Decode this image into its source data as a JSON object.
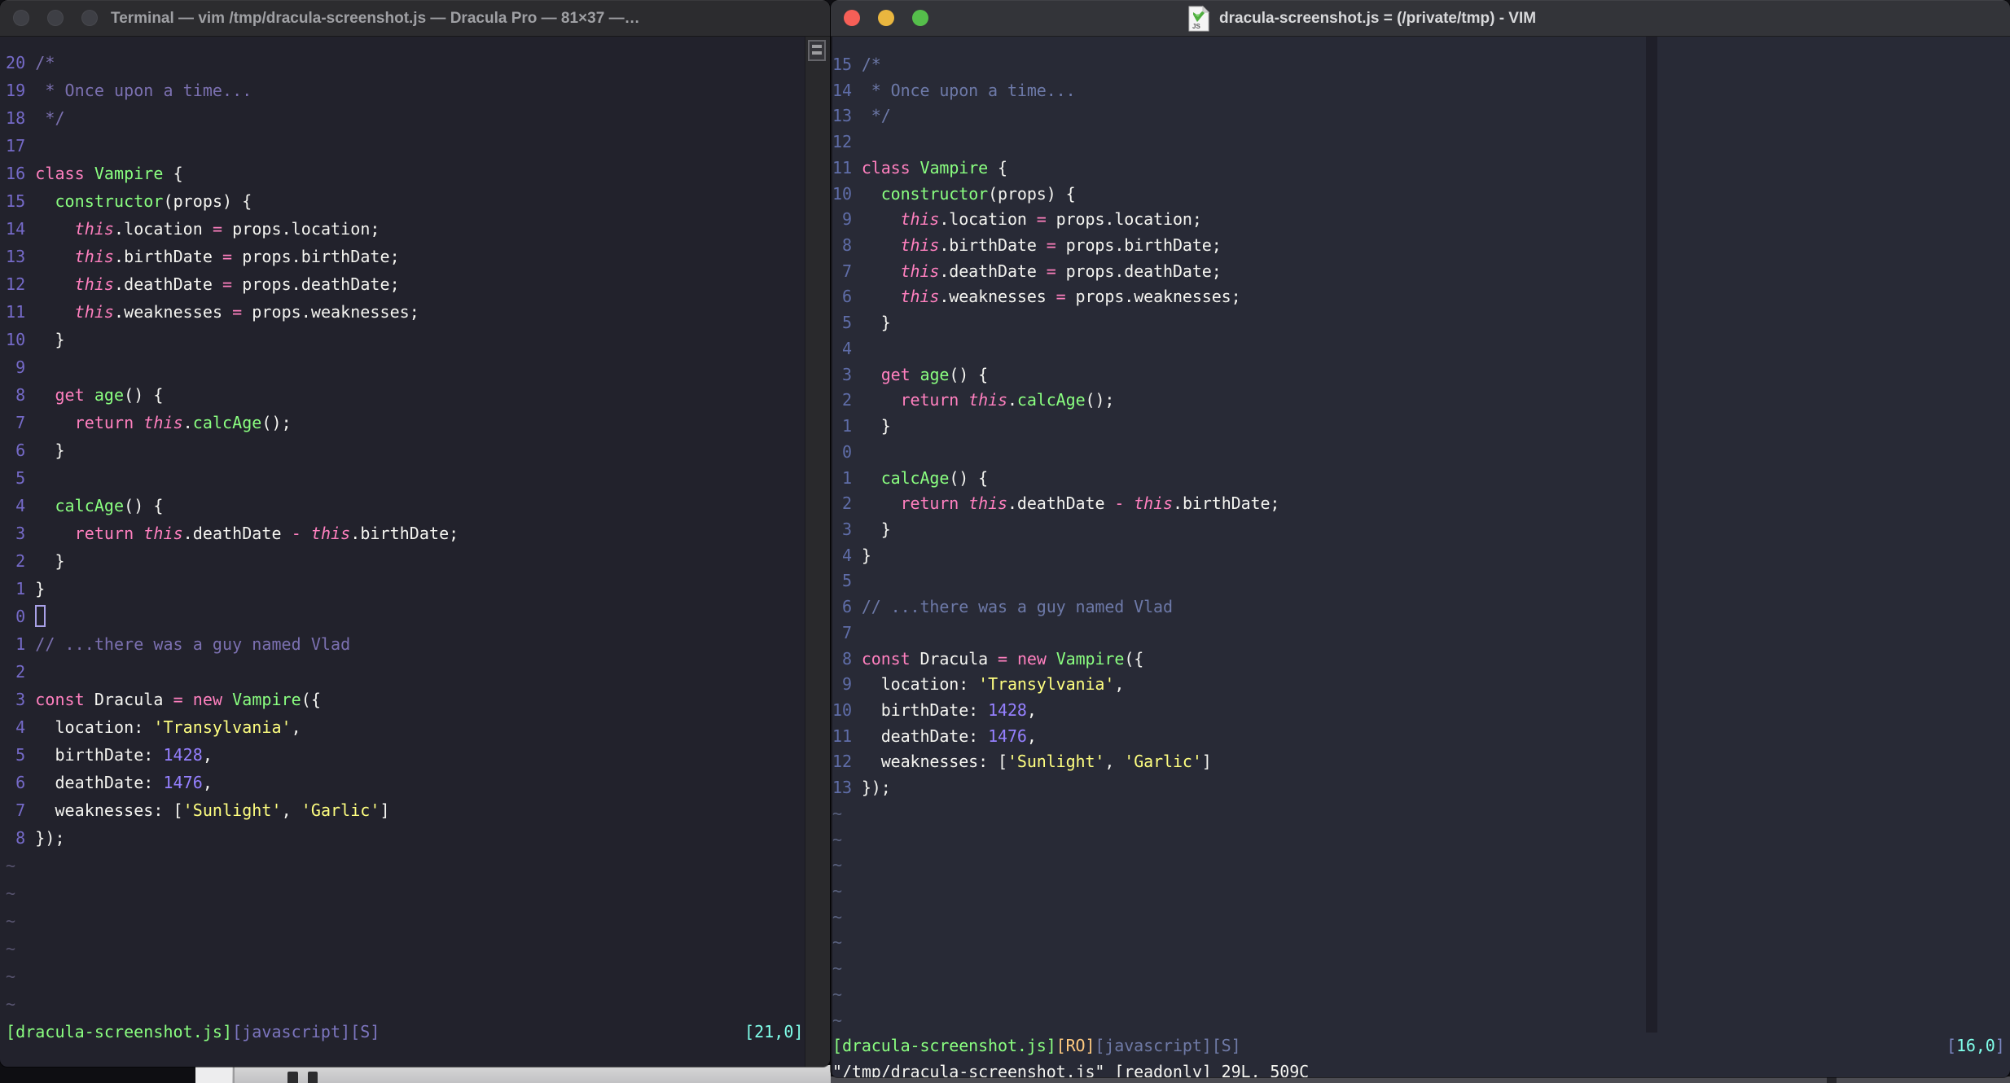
{
  "palette": {
    "shared": {
      "fg": "#F4F4F0",
      "pink": "#FF80BF",
      "green": "#8AFF80",
      "purple": "#9580FF",
      "yellow": "#FFFF80",
      "orange": "#FFCA80",
      "cyan": "#80FFEA"
    },
    "left": {
      "bg": "#22222C",
      "linenr": "#756AC8",
      "comment": "#7B70B0",
      "tilde": "#56536E",
      "slate": "#7D76C0",
      "titlebar": "#2C2C2F",
      "title_text": "#9FA0A4",
      "cursor_outline": "#A9A1E8"
    },
    "right": {
      "bg": "#282A36",
      "linenr": "#5F6DA8",
      "comment": "#6D79A8",
      "tilde": "#59617E",
      "slate": "#6F7AA6",
      "bracket": "#7B87C2",
      "titlebar": "#333439",
      "title_text": "#D8D9DB",
      "traffic_red": "#F65F57",
      "traffic_yellow": "#E9B63F",
      "traffic_green": "#55BE4B"
    }
  },
  "code_lines": [
    [
      [
        "cm",
        "/*"
      ]
    ],
    [
      [
        "cm",
        " * Once upon a time..."
      ]
    ],
    [
      [
        "cm",
        " */"
      ]
    ],
    [],
    [
      [
        "pk",
        "class"
      ],
      [
        "fg",
        " "
      ],
      [
        "gr",
        "Vampire"
      ],
      [
        "fg",
        " {"
      ]
    ],
    [
      [
        "fg",
        "  "
      ],
      [
        "gr",
        "constructor"
      ],
      [
        "fg",
        "(props) {"
      ]
    ],
    [
      [
        "fg",
        "    "
      ],
      [
        "pk",
        "this",
        "i"
      ],
      [
        "fg",
        ".location "
      ],
      [
        "pk",
        "="
      ],
      [
        "fg",
        " props.location;"
      ]
    ],
    [
      [
        "fg",
        "    "
      ],
      [
        "pk",
        "this",
        "i"
      ],
      [
        "fg",
        ".birthDate "
      ],
      [
        "pk",
        "="
      ],
      [
        "fg",
        " props.birthDate;"
      ]
    ],
    [
      [
        "fg",
        "    "
      ],
      [
        "pk",
        "this",
        "i"
      ],
      [
        "fg",
        ".deathDate "
      ],
      [
        "pk",
        "="
      ],
      [
        "fg",
        " props.deathDate;"
      ]
    ],
    [
      [
        "fg",
        "    "
      ],
      [
        "pk",
        "this",
        "i"
      ],
      [
        "fg",
        ".weaknesses "
      ],
      [
        "pk",
        "="
      ],
      [
        "fg",
        " props.weaknesses;"
      ]
    ],
    [
      [
        "fg",
        "  }"
      ]
    ],
    [],
    [
      [
        "fg",
        "  "
      ],
      [
        "pk",
        "get"
      ],
      [
        "fg",
        " "
      ],
      [
        "gr",
        "age"
      ],
      [
        "fg",
        "() {"
      ]
    ],
    [
      [
        "fg",
        "    "
      ],
      [
        "pk",
        "return"
      ],
      [
        "fg",
        " "
      ],
      [
        "pk",
        "this",
        "i"
      ],
      [
        "fg",
        "."
      ],
      [
        "gr",
        "calcAge"
      ],
      [
        "fg",
        "();"
      ]
    ],
    [
      [
        "fg",
        "  }"
      ]
    ],
    [],
    [
      [
        "fg",
        "  "
      ],
      [
        "gr",
        "calcAge"
      ],
      [
        "fg",
        "() {"
      ]
    ],
    [
      [
        "fg",
        "    "
      ],
      [
        "pk",
        "return"
      ],
      [
        "fg",
        " "
      ],
      [
        "pk",
        "this",
        "i"
      ],
      [
        "fg",
        ".deathDate "
      ],
      [
        "pk",
        "-"
      ],
      [
        "fg",
        " "
      ],
      [
        "pk",
        "this",
        "i"
      ],
      [
        "fg",
        ".birthDate;"
      ]
    ],
    [
      [
        "fg",
        "  }"
      ]
    ],
    [
      [
        "fg",
        "}"
      ]
    ],
    [],
    [
      [
        "cm",
        "// ...there was a guy named Vlad"
      ]
    ],
    [],
    [
      [
        "pk",
        "const"
      ],
      [
        "fg",
        " Dracula "
      ],
      [
        "pk",
        "="
      ],
      [
        "fg",
        " "
      ],
      [
        "pk",
        "new"
      ],
      [
        "fg",
        " "
      ],
      [
        "gr",
        "Vampire"
      ],
      [
        "fg",
        "({"
      ]
    ],
    [
      [
        "fg",
        "  location: "
      ],
      [
        "ye",
        "'Transylvania'"
      ],
      [
        "fg",
        ","
      ]
    ],
    [
      [
        "fg",
        "  birthDate: "
      ],
      [
        "pu",
        "1428"
      ],
      [
        "fg",
        ","
      ]
    ],
    [
      [
        "fg",
        "  deathDate: "
      ],
      [
        "pu",
        "1476"
      ],
      [
        "fg",
        ","
      ]
    ],
    [
      [
        "fg",
        "  weaknesses: ["
      ],
      [
        "ye",
        "'Sunlight'"
      ],
      [
        "fg",
        ", "
      ],
      [
        "ye",
        "'Garlic'"
      ],
      [
        "fg",
        "]"
      ]
    ],
    [
      [
        "fg",
        "});"
      ]
    ]
  ],
  "tilde_char": "~",
  "left_window": {
    "title": "Terminal — vim /tmp/dracula-screenshot.js — Dracula Pro — 81×37 —…",
    "rel_numbers": [
      "20 ",
      "19 ",
      "18 ",
      "17 ",
      "16 ",
      "15 ",
      "14 ",
      "13 ",
      "12 ",
      "11 ",
      "10 ",
      " 9 ",
      " 8 ",
      " 7 ",
      " 6 ",
      " 5 ",
      " 4 ",
      " 3 ",
      " 2 ",
      " 1 ",
      " 0 ",
      " 1 ",
      " 2 ",
      " 3 ",
      " 4 ",
      " 5 ",
      " 6 ",
      " 7 ",
      " 8 "
    ],
    "cursor_index": 20,
    "tilde_count": 6,
    "status_left": [
      [
        "gr",
        "[dracula-screenshot.js]"
      ],
      [
        "sl",
        "[javascript][S]"
      ]
    ],
    "status_right": [
      [
        "cy",
        "[21,0]"
      ]
    ],
    "cmd_line": ""
  },
  "right_window": {
    "title": "dracula-screenshot.js = (/private/tmp) - VIM",
    "proxy_badge": "JS",
    "rel_numbers": [
      "15 ",
      "14 ",
      "13 ",
      "12 ",
      "11 ",
      "10 ",
      " 9 ",
      " 8 ",
      " 7 ",
      " 6 ",
      " 5 ",
      " 4 ",
      " 3 ",
      " 2 ",
      " 1 ",
      " 0 ",
      " 1 ",
      " 2 ",
      " 3 ",
      " 4 ",
      " 5 ",
      " 6 ",
      " 7 ",
      " 8 ",
      " 9 ",
      "10 ",
      "11 ",
      "12 ",
      "13 "
    ],
    "cursor_index": -1,
    "tilde_count": 9,
    "status_left": [
      [
        "gr",
        "[dracula-screenshot.js]"
      ],
      [
        "or",
        "[RO]"
      ],
      [
        "sl",
        "[javascript][S]"
      ]
    ],
    "status_right": [
      [
        "br",
        "["
      ],
      [
        "cy",
        "16,0"
      ],
      [
        "br",
        "]"
      ]
    ],
    "cmd_line": "\"/tmp/dracula-screenshot.js\" [readonly] 29L, 509C"
  }
}
